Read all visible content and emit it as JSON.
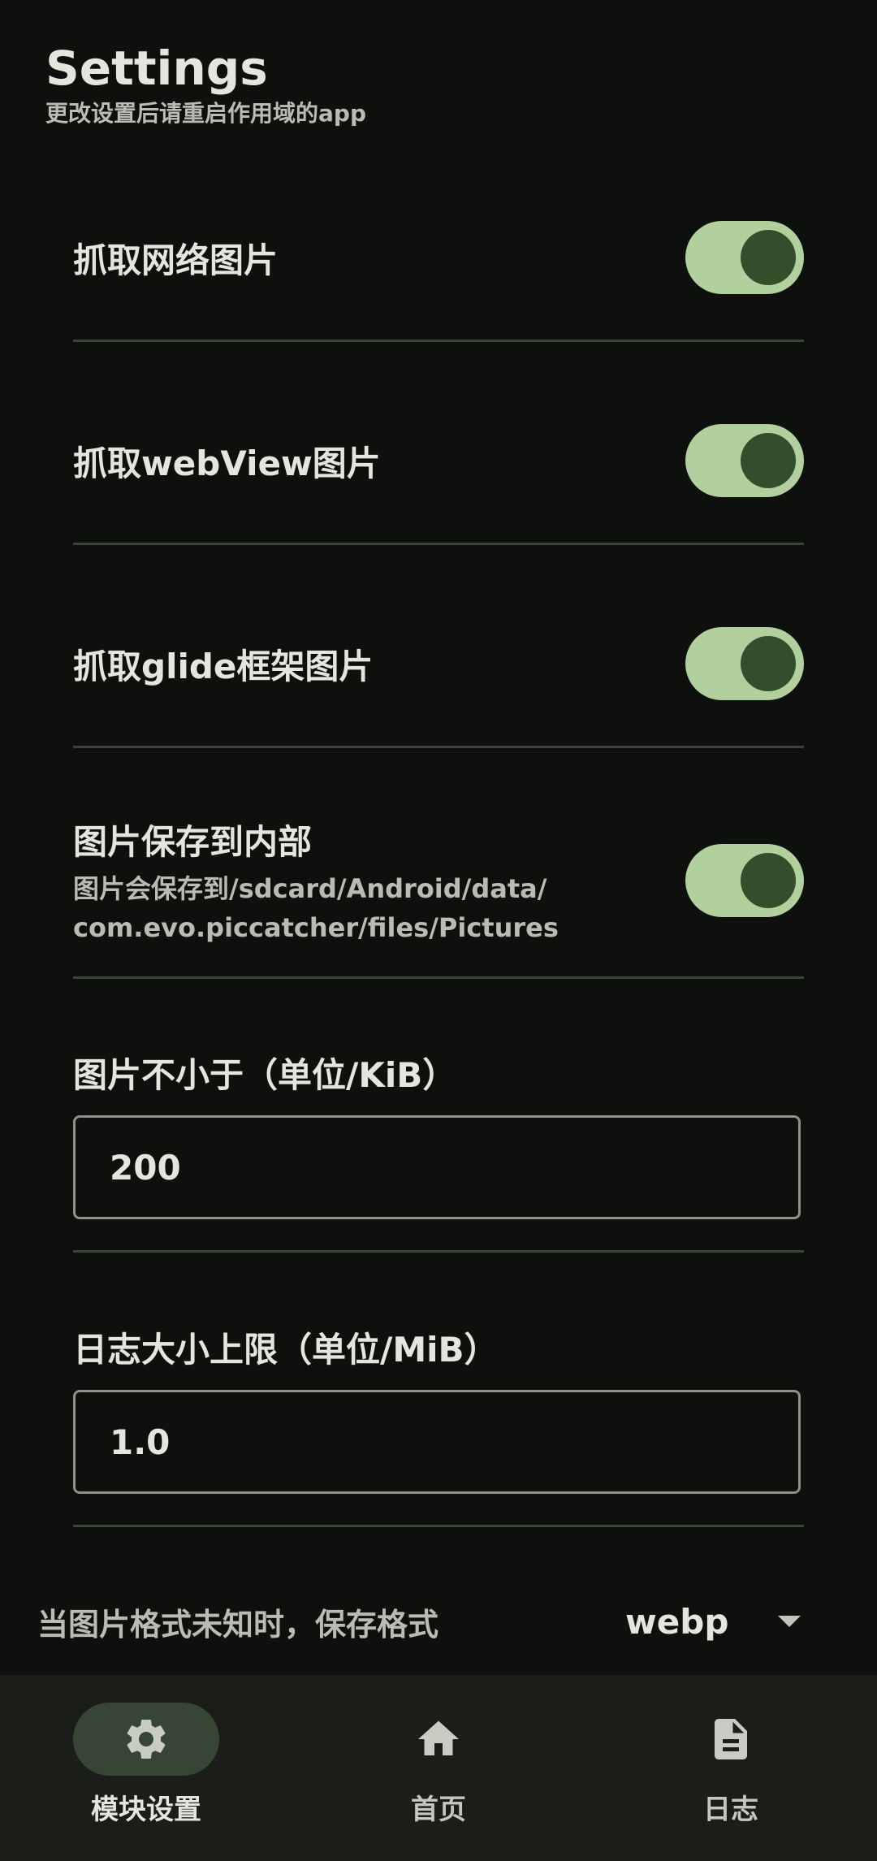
{
  "header": {
    "title": "Settings",
    "subtitle": "更改设置后请重启作用域的app"
  },
  "settings": {
    "toggles": [
      {
        "label": "抓取网络图片",
        "checked": true
      },
      {
        "label": "抓取webView图片",
        "checked": true
      },
      {
        "label": "抓取glide框架图片",
        "checked": true
      },
      {
        "label": "图片保存到内部",
        "description": "图片会保存到/sdcard/Android/data/\ncom.evo.piccatcher/files/Pictures",
        "checked": true
      }
    ],
    "min_size": {
      "label": "图片不小于（单位/KiB）",
      "value": "200"
    },
    "log_limit": {
      "label": "日志大小上限（单位/MiB）",
      "value": "1.0"
    },
    "format": {
      "label": "当图片格式未知时，保存格式",
      "value": "webp"
    }
  },
  "nav": {
    "items": [
      {
        "label": "模块设置",
        "icon": "gear-icon",
        "active": true
      },
      {
        "label": "首页",
        "icon": "home-icon",
        "active": false
      },
      {
        "label": "日志",
        "icon": "document-icon",
        "active": false
      }
    ]
  },
  "colors": {
    "background": "#0e100d",
    "switch_track": "#b1d09e",
    "switch_thumb": "#344d2a",
    "nav_background": "#1a1d18",
    "nav_active_pill": "#374634"
  }
}
